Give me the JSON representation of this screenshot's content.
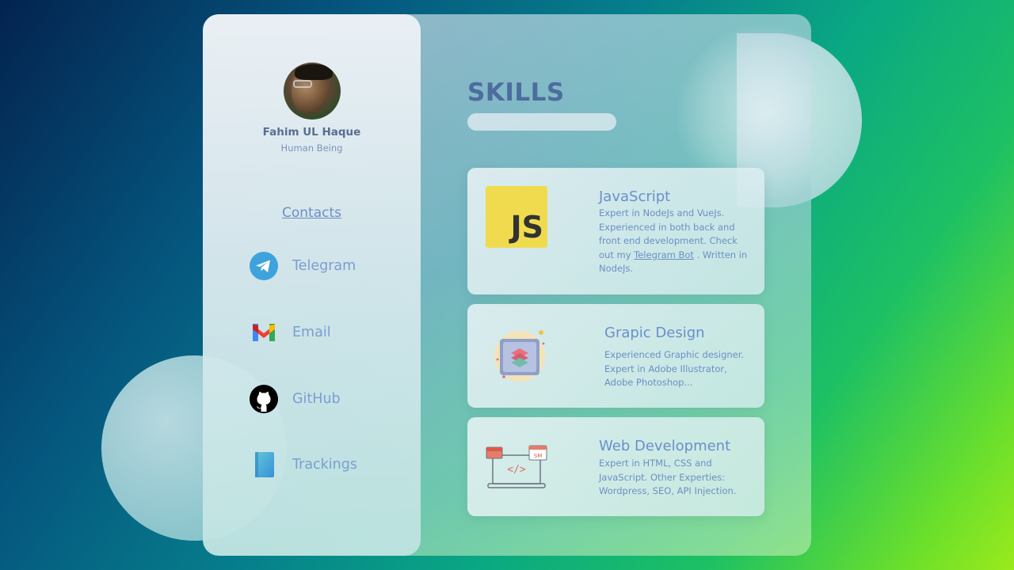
{
  "profile": {
    "name": "Fahim UL Haque",
    "role": "Human Being"
  },
  "contacts": {
    "title": "Contacts",
    "items": [
      {
        "label": "Telegram",
        "icon": "telegram-icon"
      },
      {
        "label": "Email",
        "icon": "gmail-icon"
      },
      {
        "label": "GitHub",
        "icon": "github-icon"
      },
      {
        "label": "Trackings",
        "icon": "book-icon"
      }
    ]
  },
  "skills": {
    "title": "SKILLS",
    "cards": [
      {
        "title": "JavaScript",
        "icon_text": "JS",
        "desc_before": "Expert in NodeJs and VueJs. Experienced in both back and front end development. Check out my",
        "link": "Telegram Bot",
        "desc_after": ". Written in NodeJs."
      },
      {
        "title": "Grapic Design",
        "desc": "Experienced Graphic designer. Expert in Adobe Illustrator, Adobe Photoshop..."
      },
      {
        "title": "Web Development",
        "icon_code": "</>",
        "icon_calendar": "SM",
        "desc": "Expert in HTML, CSS and JavaScript. Other Experties: Wordpress, SEO, API Injection."
      }
    ]
  },
  "colors": {
    "accent": "#6c8fc4",
    "title": "#4c6d9d",
    "js_yellow": "#f0db4f",
    "telegram_blue": "#3ea3dc"
  }
}
